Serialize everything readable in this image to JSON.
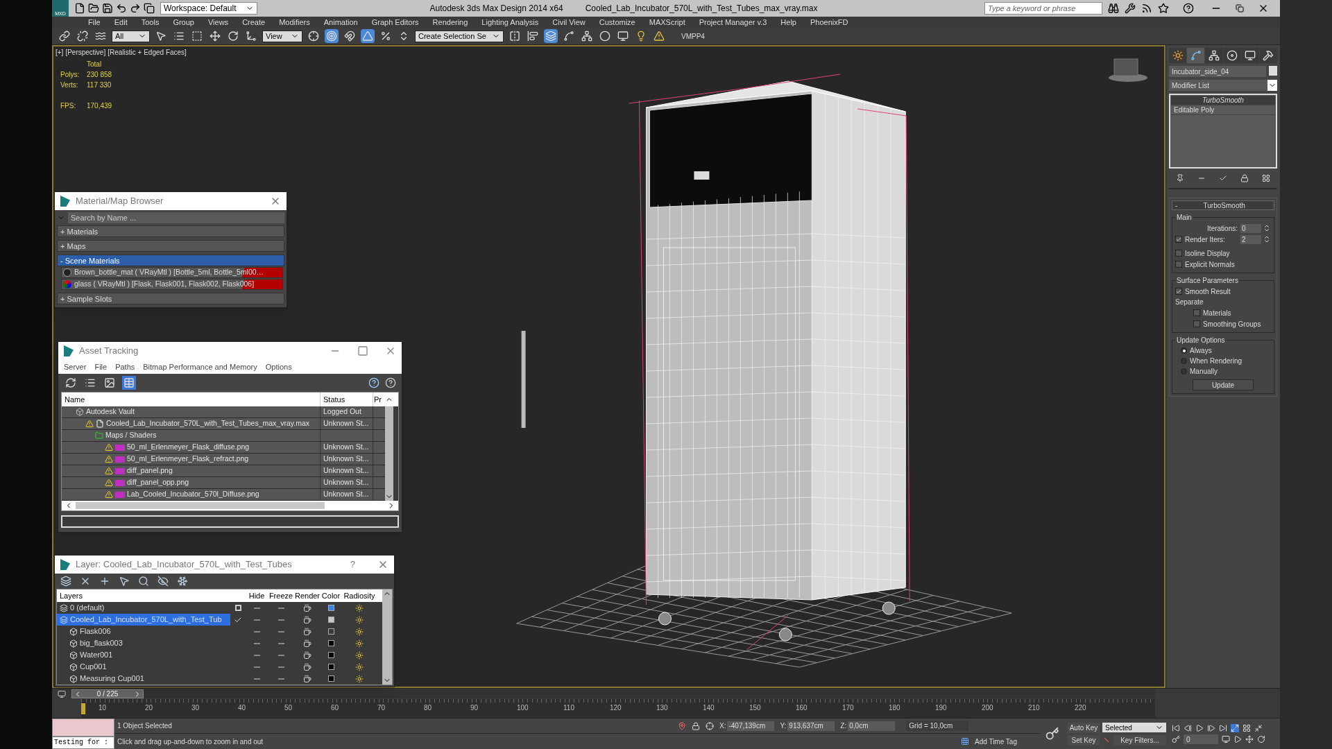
{
  "title_bar": {
    "logo": "MXD",
    "workspace": "Workspace: Default",
    "app_title": "Autodesk 3ds Max Design 2014 x64",
    "file_title": "Cooled_Lab_Incubator_570L_with_Test_Tubes_max_vray.max",
    "search": {
      "placeholder": "Type a keyword or phrase"
    }
  },
  "menu": [
    "File",
    "Edit",
    "Tools",
    "Group",
    "Views",
    "Create",
    "Modifiers",
    "Animation",
    "Graph Editors",
    "Rendering",
    "Lighting Analysis",
    "Civil View",
    "Customize",
    "MAXScript",
    "Project Manager v.3",
    "Help",
    "PhoenixFD"
  ],
  "main_toolbar": {
    "selection_filter": "All",
    "coordinate_system": "View",
    "named_selection": "Create Selection Se",
    "plugin_label": "VMPP4",
    "buttons": [
      {
        "kind": "link",
        "selected": false
      },
      {
        "kind": "unlink",
        "selected": false
      },
      {
        "kind": "bind",
        "selected": false
      },
      {
        "kind": "select",
        "selected": false
      },
      {
        "kind": "select-by-name",
        "selected": false
      },
      {
        "kind": "region",
        "selected": false
      },
      {
        "kind": "move",
        "selected": false
      },
      {
        "kind": "rotate",
        "selected": false
      },
      {
        "kind": "scale",
        "selected": false
      },
      {
        "kind": "pivot",
        "selected": false
      },
      {
        "kind": "manipulate",
        "selected": true
      },
      {
        "kind": "snap",
        "selected": false
      },
      {
        "kind": "angle-snap",
        "selected": true
      },
      {
        "kind": "percent-snap",
        "selected": false
      },
      {
        "kind": "spinner-snap",
        "selected": false
      },
      {
        "kind": "mirror",
        "selected": false
      },
      {
        "kind": "align",
        "selected": false
      },
      {
        "kind": "layers",
        "selected": true
      },
      {
        "kind": "graph",
        "selected": false
      },
      {
        "kind": "schematic",
        "selected": false
      },
      {
        "kind": "material",
        "selected": false
      },
      {
        "kind": "render",
        "selected": false
      },
      {
        "kind": "light",
        "selected": false
      },
      {
        "kind": "warning",
        "selected": false
      }
    ]
  },
  "viewport": {
    "labels": [
      "[+]",
      "[Perspective]",
      "[Realistic + Edged Faces]"
    ],
    "stats_header": "Total",
    "stats": [
      {
        "label": "Polys:",
        "value": "230 858"
      },
      {
        "label": "Verts:",
        "value": "117 330"
      },
      {
        "label": "FPS:",
        "value": "170,439"
      }
    ]
  },
  "material_browser": {
    "title": "Material/Map Browser",
    "search": {
      "placeholder": "Search by Name ..."
    },
    "groups": [
      {
        "sign": "+",
        "label": "Materials",
        "expanded": false
      },
      {
        "sign": "+",
        "label": "Maps",
        "expanded": false
      },
      {
        "sign": "-",
        "label": "Scene Materials",
        "expanded": true,
        "items": [
          "Brown_bottle_mat ( VRayMtl ) [Bottle_5ml, Bottle_5ml00…",
          "glass ( VRayMtl ) [Flask, Flask001, Flask002, Flask006]"
        ]
      },
      {
        "sign": "+",
        "label": "Sample Slots",
        "expanded": false
      }
    ]
  },
  "asset_tracking": {
    "title": "Asset Tracking",
    "menu": [
      "Server",
      "File",
      "Paths",
      "Bitmap Performance and Memory",
      "Options"
    ],
    "toolbar": [
      {
        "kind": "refresh",
        "selected": false
      },
      {
        "kind": "list",
        "selected": false
      },
      {
        "kind": "thumbnails",
        "selected": false
      },
      {
        "kind": "table",
        "selected": true
      }
    ],
    "columns": [
      "Name",
      "Status",
      "Pr"
    ],
    "rows": [
      {
        "kind": "vault",
        "name": "Autodesk Vault",
        "status": "Logged Out",
        "warning": false,
        "children": [
          {
            "kind": "file",
            "name": "Cooled_Lab_Incubator_570L_with_Test_Tubes_max_vray.max",
            "status": "Unknown St...",
            "warning": true,
            "children": [
              {
                "kind": "folder",
                "name": "Maps / Shaders",
                "warning": false,
                "children": [
                  {
                    "kind": "png",
                    "name": "50_ml_Erlenmeyer_Flask_diffuse.png",
                    "status": "Unknown St...",
                    "warning": true
                  },
                  {
                    "kind": "png",
                    "name": "50_ml_Erlenmeyer_Flask_refract.png",
                    "status": "Unknown St...",
                    "warning": true
                  },
                  {
                    "kind": "png",
                    "name": "diff_panel.png",
                    "status": "Unknown St...",
                    "warning": true
                  },
                  {
                    "kind": "png",
                    "name": "diff_panel_opp.png",
                    "status": "Unknown St...",
                    "warning": true
                  },
                  {
                    "kind": "png",
                    "name": "Lab_Cooled_Incubator_570l_Diffuse.png",
                    "status": "Unknown St...",
                    "warning": true
                  }
                ]
              }
            ]
          }
        ]
      }
    ]
  },
  "layer_window": {
    "title": "Layer: Cooled_Lab_Incubator_570L_with_Test_Tubes",
    "help": "?",
    "columns": [
      "Layers",
      "Hide",
      "Freeze",
      "Render",
      "Color",
      "Radiosity"
    ],
    "rows": [
      {
        "kind": "layer",
        "name": "0 (default)",
        "current": false,
        "selected": false,
        "color": "#3f7fe0"
      },
      {
        "kind": "layer",
        "name": "Cooled_Lab_Incubator_570L_with_Test_Tub",
        "current": true,
        "selected": true,
        "color": "#c8c8c8",
        "children": [
          {
            "kind": "object",
            "name": "Flask006",
            "selected": false,
            "color": "#3a3a3a"
          },
          {
            "kind": "object",
            "name": "big_flask003",
            "selected": false,
            "color": "#000000"
          },
          {
            "kind": "object",
            "name": "Water001",
            "selected": false,
            "color": "#000000"
          },
          {
            "kind": "object",
            "name": "Cup001",
            "selected": false,
            "color": "#000000"
          },
          {
            "kind": "object",
            "name": "Measuring Cup001",
            "selected": false,
            "color": "#000000"
          }
        ]
      }
    ]
  },
  "command_panel": {
    "tabs": [
      {
        "kind": "create",
        "selected": false
      },
      {
        "kind": "modify",
        "selected": true
      },
      {
        "kind": "hierarchy",
        "selected": false
      },
      {
        "kind": "motion",
        "selected": false
      },
      {
        "kind": "display",
        "selected": false
      },
      {
        "kind": "utilities",
        "selected": false
      }
    ],
    "object_name": "Incubator_side_04",
    "modifier_list": "Modifier List",
    "stack": [
      {
        "name": "TurboSmooth",
        "selected": true
      },
      {
        "name": "Editable Poly",
        "selected": false
      }
    ],
    "rollout": {
      "sign": "-",
      "title": "TurboSmooth",
      "main": {
        "label": "Main",
        "iterations": {
          "label": "Iterations:",
          "value": "0"
        },
        "render_iters": {
          "label": "Render Iters:",
          "value": "2",
          "checked": true
        },
        "options": [
          {
            "label": "Isoline Display",
            "checked": false
          },
          {
            "label": "Explicit Normals",
            "checked": false
          }
        ]
      },
      "surface": {
        "label": "Surface Parameters",
        "smooth_result": {
          "label": "Smooth Result",
          "checked": true
        },
        "separate": "Separate",
        "options": [
          {
            "label": "Materials",
            "checked": false
          },
          {
            "label": "Smoothing Groups",
            "checked": false
          }
        ]
      },
      "update": {
        "label": "Update Options",
        "radios": [
          {
            "label": "Always",
            "selected": true
          },
          {
            "label": "When Rendering",
            "selected": false
          },
          {
            "label": "Manually",
            "selected": false
          }
        ],
        "button": "Update"
      }
    }
  },
  "timeline": {
    "position": "0 / 225",
    "level": 0,
    "ticks": [
      "10",
      "20",
      "30",
      "40",
      "50",
      "60",
      "70",
      "80",
      "90",
      "100",
      "110",
      "120",
      "130",
      "140",
      "150",
      "160",
      "170",
      "180",
      "190",
      "200",
      "210",
      "220"
    ]
  },
  "status_bar": {
    "listener": "Testing for :",
    "selection": "1 Object Selected",
    "prompt": "Click and drag up-and-down to zoom in and out",
    "x": {
      "label": "X:",
      "value": "-407,139cm"
    },
    "y": {
      "label": "Y:",
      "value": "913,637cm"
    },
    "z": {
      "label": "Z:",
      "value": "0,0cm"
    },
    "grid": "Grid = 10,0cm",
    "time_tag": "Add Time Tag",
    "auto_key": "Auto Key",
    "key_mode": "Selected",
    "set_key": "Set Key",
    "key_filters": "Key Filters...",
    "frame": "0"
  }
}
